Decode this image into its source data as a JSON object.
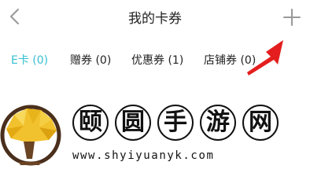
{
  "header": {
    "title": "我的卡券",
    "back_icon": "chevron-left-icon",
    "add_icon": "plus-icon"
  },
  "tabs": [
    {
      "label": "E卡 (0)",
      "active": true
    },
    {
      "label": "赠券 (0)",
      "active": false
    },
    {
      "label": "优惠券 (1)",
      "active": false
    },
    {
      "label": "店铺券 (0)",
      "active": false
    }
  ],
  "colors": {
    "accent": "#36bfd0",
    "arrow": "#e41e1e",
    "text": "#222222",
    "icon": "#999999"
  },
  "watermark": {
    "chars": [
      "颐",
      "圆",
      "手",
      "游",
      "网"
    ],
    "url": "www.shyiyuanyk.com"
  }
}
